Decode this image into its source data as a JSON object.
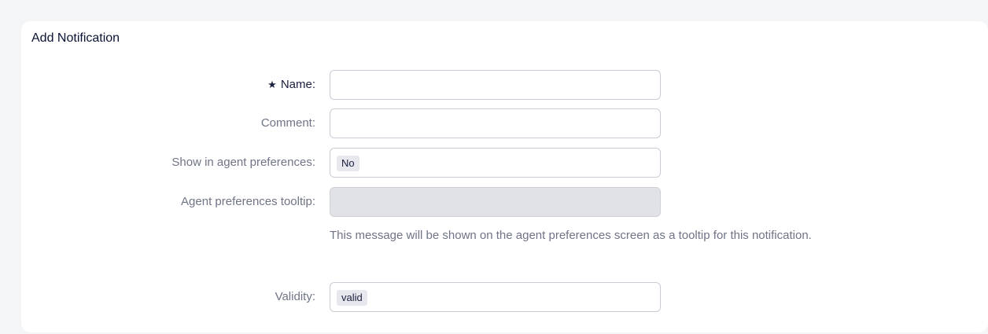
{
  "panel": {
    "title": "Add Notification"
  },
  "form": {
    "required_mark": "★",
    "name": {
      "label": "Name:",
      "value": ""
    },
    "comment": {
      "label": "Comment:",
      "value": ""
    },
    "visible_for_agent": {
      "label": "Show in agent preferences:",
      "selected": "No"
    },
    "tooltip": {
      "label": "Agent preferences tooltip:",
      "value": "",
      "disabled": true,
      "help": "This message will be shown on the agent preferences screen as a tooltip for this notification."
    },
    "validity": {
      "label": "Validity:",
      "selected": "valid"
    }
  }
}
